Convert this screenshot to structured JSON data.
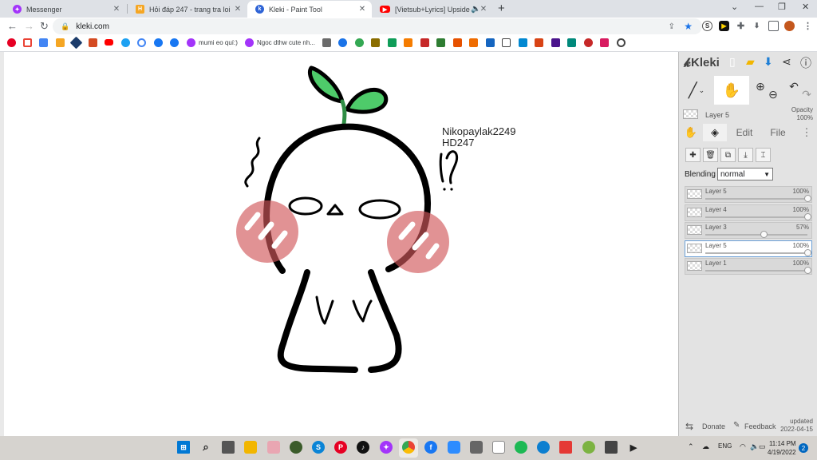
{
  "browser": {
    "tabs": [
      {
        "title": "Messenger",
        "icon": "messenger-icon",
        "color": "#a334fa",
        "active": false
      },
      {
        "title": "Hỏi đáp 247 - trang tra loi",
        "icon": "hoidap247-icon",
        "color": "#f5a623",
        "active": false
      },
      {
        "title": "Kleki - Paint Tool",
        "icon": "kleki-icon",
        "color": "#2f64d6",
        "active": true
      },
      {
        "title": "[Vietsub+Lyrics] Upside Dov",
        "icon": "youtube-icon",
        "color": "#ff0000",
        "active": false
      }
    ],
    "new_tab": "+",
    "url": "kleki.com",
    "bookmarks": [
      {
        "label": "mumi eo quí:)",
        "color": "#a334fa"
      },
      {
        "label": "Ngoc dthw cute nh...",
        "color": "#a334fa"
      }
    ]
  },
  "drawing": {
    "signature_line1": "Nikopaylak2249",
    "signature_line2": "HD247"
  },
  "kleki": {
    "logo": "Kleki",
    "current_layer": "Layer 5",
    "opacity_label": "Opacity",
    "opacity_value": "100%",
    "panel_tabs": [
      "Edit",
      "File"
    ],
    "blending_label": "Blending",
    "blending_value": "normal",
    "layers": [
      {
        "name": "Layer 5",
        "opacity": "100%",
        "level": 1.0,
        "active": false
      },
      {
        "name": "Layer 4",
        "opacity": "100%",
        "level": 1.0,
        "active": false
      },
      {
        "name": "Layer 3",
        "opacity": "57%",
        "level": 0.57,
        "active": false
      },
      {
        "name": "Layer 5",
        "opacity": "100%",
        "level": 1.0,
        "active": true
      },
      {
        "name": "Layer 1",
        "opacity": "100%",
        "level": 1.0,
        "active": false
      }
    ],
    "footer": {
      "donate": "Donate",
      "feedback": "Feedback",
      "updated_label": "updated",
      "updated_date": "2022-04-15"
    }
  },
  "taskbar": {
    "language": "ENG",
    "time": "11:14 PM",
    "date": "4/19/2022",
    "notification_count": "2"
  }
}
